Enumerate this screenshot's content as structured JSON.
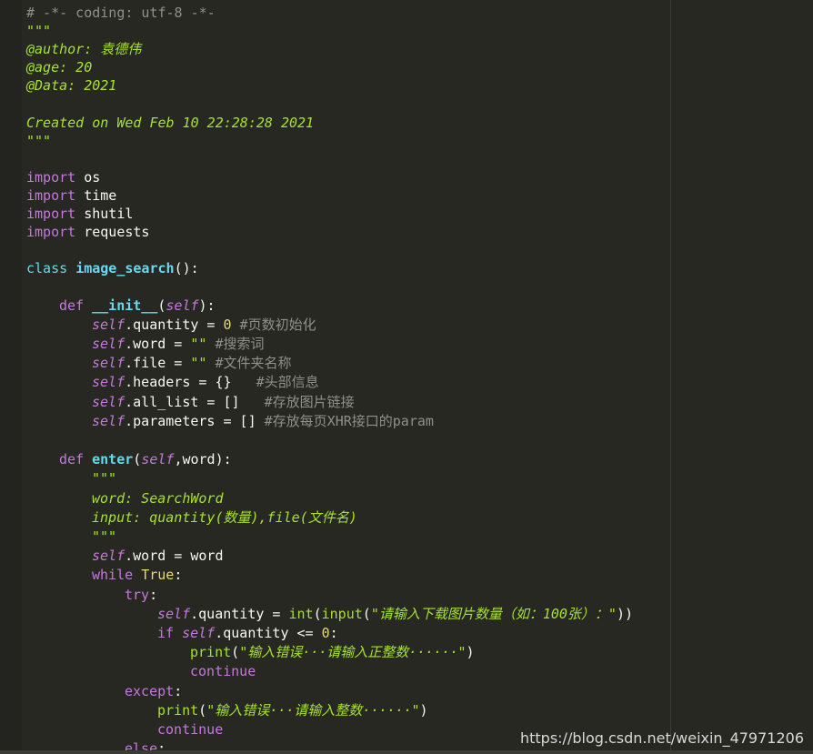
{
  "editor": {
    "lines": [
      {
        "row": 0,
        "indent": 0,
        "tokens": [
          {
            "t": "comment",
            "v": "# -*- coding: utf-8 -*-"
          }
        ]
      },
      {
        "row": 1,
        "indent": 0,
        "tokens": [
          {
            "t": "doc",
            "v": "\"\"\""
          }
        ]
      },
      {
        "row": 2,
        "indent": 0,
        "tokens": [
          {
            "t": "doc",
            "v": "@author: 袁德伟"
          }
        ]
      },
      {
        "row": 3,
        "indent": 0,
        "tokens": [
          {
            "t": "doc",
            "v": "@age: 20"
          }
        ]
      },
      {
        "row": 4,
        "indent": 0,
        "tokens": [
          {
            "t": "doc",
            "v": "@Data: 2021"
          }
        ]
      },
      {
        "row": 6,
        "indent": 0,
        "tokens": [
          {
            "t": "doc",
            "v": "Created on Wed Feb 10 22:28:28 2021"
          }
        ]
      },
      {
        "row": 7,
        "indent": 0,
        "tokens": [
          {
            "t": "doc",
            "v": "\"\"\""
          }
        ]
      },
      {
        "row": 9,
        "indent": 0,
        "tokens": [
          {
            "t": "kw",
            "v": "import"
          },
          {
            "t": "txt",
            "v": " os"
          }
        ]
      },
      {
        "row": 10,
        "indent": 0,
        "tokens": [
          {
            "t": "kw",
            "v": "import"
          },
          {
            "t": "txt",
            "v": " time"
          }
        ]
      },
      {
        "row": 11,
        "indent": 0,
        "tokens": [
          {
            "t": "kw",
            "v": "import"
          },
          {
            "t": "txt",
            "v": " shutil"
          }
        ]
      },
      {
        "row": 12,
        "indent": 0,
        "tokens": [
          {
            "t": "kw",
            "v": "import"
          },
          {
            "t": "txt",
            "v": " requests"
          }
        ]
      },
      {
        "row": 14,
        "indent": 0,
        "tokens": [
          {
            "t": "kw2",
            "v": "class"
          },
          {
            "t": "txt",
            "v": " "
          },
          {
            "t": "fn",
            "v": "image_search"
          },
          {
            "t": "txt",
            "v": "():"
          }
        ]
      },
      {
        "row": 16,
        "indent": 1,
        "tokens": [
          {
            "t": "kw",
            "v": "def"
          },
          {
            "t": "txt",
            "v": " "
          },
          {
            "t": "fn",
            "v": "__init__"
          },
          {
            "t": "txt",
            "v": "("
          },
          {
            "t": "self",
            "v": "self"
          },
          {
            "t": "txt",
            "v": "):"
          }
        ]
      },
      {
        "row": 17,
        "indent": 2,
        "tokens": [
          {
            "t": "self",
            "v": "self"
          },
          {
            "t": "txt",
            "v": ".quantity = "
          },
          {
            "t": "num",
            "v": "0"
          },
          {
            "t": "comment",
            "v": " #页数初始化"
          }
        ]
      },
      {
        "row": 18,
        "indent": 2,
        "tokens": [
          {
            "t": "self",
            "v": "self"
          },
          {
            "t": "txt",
            "v": ".word = "
          },
          {
            "t": "str",
            "v": "\"\""
          },
          {
            "t": "comment",
            "v": " #搜索词"
          }
        ]
      },
      {
        "row": 19,
        "indent": 2,
        "tokens": [
          {
            "t": "self",
            "v": "self"
          },
          {
            "t": "txt",
            "v": ".file = "
          },
          {
            "t": "str",
            "v": "\"\""
          },
          {
            "t": "comment",
            "v": " #文件夹名称"
          }
        ]
      },
      {
        "row": 20,
        "indent": 2,
        "tokens": [
          {
            "t": "self",
            "v": "self"
          },
          {
            "t": "txt",
            "v": ".headers = {}"
          },
          {
            "t": "comment",
            "v": "   #头部信息"
          }
        ]
      },
      {
        "row": 21,
        "indent": 2,
        "tokens": [
          {
            "t": "self",
            "v": "self"
          },
          {
            "t": "txt",
            "v": ".all_list = []"
          },
          {
            "t": "comment",
            "v": "   #存放图片链接"
          }
        ]
      },
      {
        "row": 22,
        "indent": 2,
        "tokens": [
          {
            "t": "self",
            "v": "self"
          },
          {
            "t": "txt",
            "v": ".parameters = []"
          },
          {
            "t": "comment",
            "v": " #存放每页XHR接口的param"
          }
        ]
      },
      {
        "row": 24,
        "indent": 1,
        "tokens": [
          {
            "t": "kw",
            "v": "def"
          },
          {
            "t": "txt",
            "v": " "
          },
          {
            "t": "fn",
            "v": "enter"
          },
          {
            "t": "txt",
            "v": "("
          },
          {
            "t": "self",
            "v": "self"
          },
          {
            "t": "txt",
            "v": ",word):"
          }
        ]
      },
      {
        "row": 25,
        "indent": 2,
        "tokens": [
          {
            "t": "doc",
            "v": "\"\"\""
          }
        ]
      },
      {
        "row": 26,
        "indent": 2,
        "tokens": [
          {
            "t": "doc",
            "v": "word: SearchWord"
          }
        ]
      },
      {
        "row": 27,
        "indent": 2,
        "tokens": [
          {
            "t": "doc",
            "v": "input: quantity(数量),file(文件名)"
          }
        ]
      },
      {
        "row": 28,
        "indent": 2,
        "tokens": [
          {
            "t": "doc",
            "v": "\"\"\""
          }
        ]
      },
      {
        "row": 29,
        "indent": 2,
        "tokens": [
          {
            "t": "self",
            "v": "self"
          },
          {
            "t": "txt",
            "v": ".word = word"
          }
        ]
      },
      {
        "row": 30,
        "indent": 2,
        "tokens": [
          {
            "t": "kw",
            "v": "while"
          },
          {
            "t": "txt",
            "v": " "
          },
          {
            "t": "const",
            "v": "True"
          },
          {
            "t": "txt",
            "v": ":"
          }
        ]
      },
      {
        "row": 31,
        "indent": 3,
        "tokens": [
          {
            "t": "kw",
            "v": "try"
          },
          {
            "t": "txt",
            "v": ":"
          }
        ]
      },
      {
        "row": 32,
        "indent": 4,
        "tokens": [
          {
            "t": "self",
            "v": "self"
          },
          {
            "t": "txt",
            "v": ".quantity = "
          },
          {
            "t": "builtin",
            "v": "int"
          },
          {
            "t": "txt",
            "v": "("
          },
          {
            "t": "builtin",
            "v": "input"
          },
          {
            "t": "txt",
            "v": "("
          },
          {
            "t": "str",
            "v": "\"请输入下载图片数量（如：100张）：\""
          },
          {
            "t": "txt",
            "v": "))"
          }
        ]
      },
      {
        "row": 33,
        "indent": 4,
        "tokens": [
          {
            "t": "kw",
            "v": "if"
          },
          {
            "t": "txt",
            "v": " "
          },
          {
            "t": "self",
            "v": "self"
          },
          {
            "t": "txt",
            "v": ".quantity <= "
          },
          {
            "t": "num",
            "v": "0"
          },
          {
            "t": "txt",
            "v": ":"
          }
        ]
      },
      {
        "row": 34,
        "indent": 5,
        "tokens": [
          {
            "t": "builtin",
            "v": "print"
          },
          {
            "t": "txt",
            "v": "("
          },
          {
            "t": "str",
            "v": "\"输入错误···请输入正整数······\""
          },
          {
            "t": "txt",
            "v": ")"
          }
        ]
      },
      {
        "row": 35,
        "indent": 5,
        "tokens": [
          {
            "t": "kw",
            "v": "continue"
          }
        ]
      },
      {
        "row": 36,
        "indent": 3,
        "tokens": [
          {
            "t": "kw",
            "v": "except"
          },
          {
            "t": "txt",
            "v": ":"
          }
        ]
      },
      {
        "row": 37,
        "indent": 4,
        "tokens": [
          {
            "t": "builtin",
            "v": "print"
          },
          {
            "t": "txt",
            "v": "("
          },
          {
            "t": "str",
            "v": "\"输入错误···请输入整数······\""
          },
          {
            "t": "txt",
            "v": ")"
          }
        ]
      },
      {
        "row": 38,
        "indent": 4,
        "tokens": [
          {
            "t": "kw",
            "v": "continue"
          }
        ]
      },
      {
        "row": 39,
        "indent": 3,
        "tokens": [
          {
            "t": "kw",
            "v": "else"
          },
          {
            "t": "txt",
            "v": ":"
          }
        ]
      }
    ]
  },
  "watermark": "https://blog.csdn.net/weixin_47971206",
  "colors": {
    "background": "#272822",
    "keyword": "#c678dd",
    "function": "#66d9ef",
    "docstring": "#a6e22e",
    "number": "#e6db74",
    "comment": "#8f908a"
  }
}
